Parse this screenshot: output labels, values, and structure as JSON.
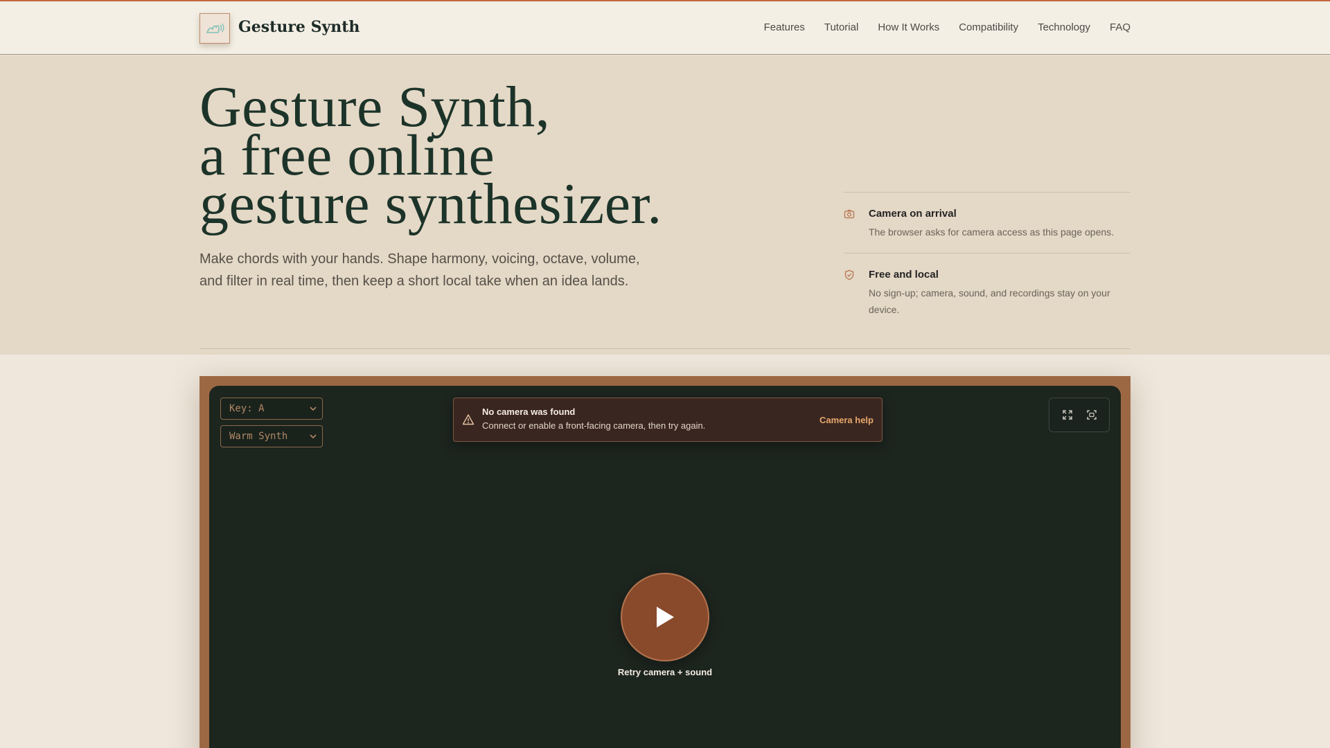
{
  "brand": {
    "name": "Gesture Synth"
  },
  "nav": {
    "items": [
      {
        "label": "Features"
      },
      {
        "label": "Tutorial"
      },
      {
        "label": "How It Works"
      },
      {
        "label": "Compatibility"
      },
      {
        "label": "Technology"
      },
      {
        "label": "FAQ"
      }
    ]
  },
  "hero": {
    "title_line1": "Gesture Synth,",
    "title_line2": "a free online",
    "title_line3": "gesture synthesizer.",
    "subtitle": "Make chords with your hands. Shape harmony, voicing, octave, volume, and filter in real time, then keep a short local take when an idea lands."
  },
  "features": [
    {
      "icon": "camera-icon",
      "title": "Camera on arrival",
      "text": "The browser asks for camera access as this page opens."
    },
    {
      "icon": "shield-icon",
      "title": "Free and local",
      "text": "No sign-up; camera, sound, and recordings stay on your device."
    }
  ],
  "app": {
    "key_select": "Key: A",
    "sound_select": "Warm Synth",
    "alert": {
      "title": "No camera was found",
      "text": "Connect or enable a front-facing camera, then try again.",
      "link": "Camera help"
    },
    "play_label": "Retry camera + sound"
  },
  "colors": {
    "accent": "#894a2c",
    "header_line": "#c2683e",
    "hero_bg": "#e4d8c6",
    "title": "#1c3329",
    "screen_bg": "#1d251f"
  }
}
